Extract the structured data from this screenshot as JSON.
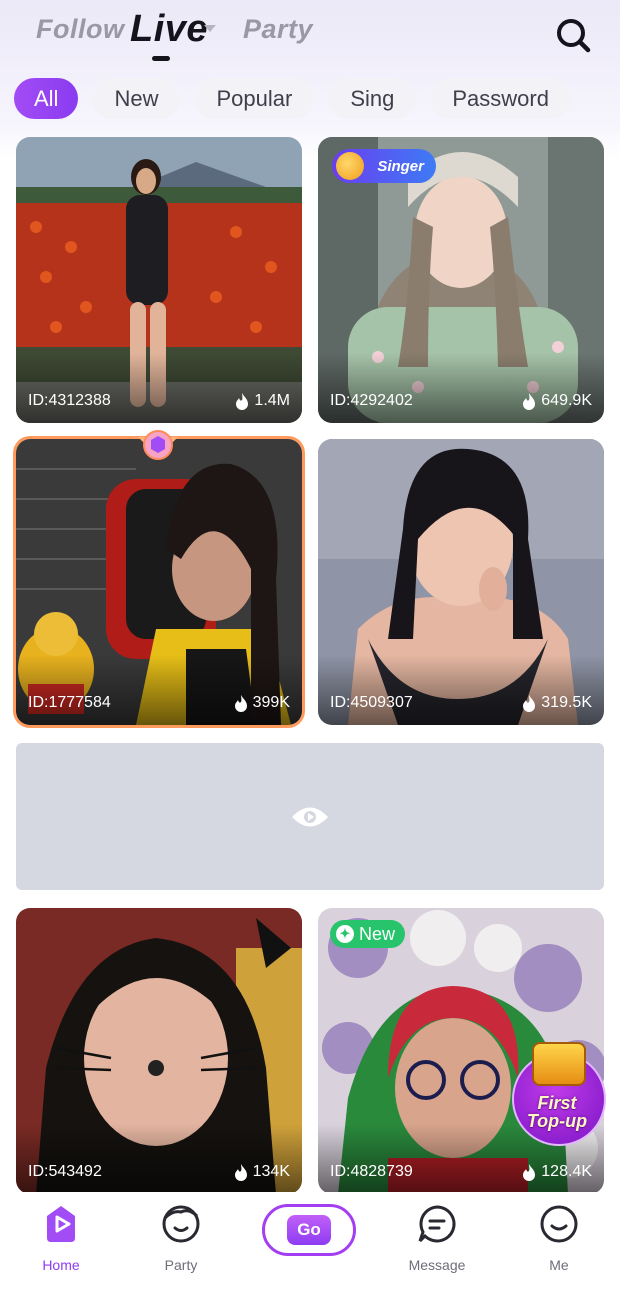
{
  "top_tabs": {
    "follow": "Follow",
    "live": "Live",
    "party": "Party"
  },
  "filters": [
    "All",
    "New",
    "Popular",
    "Sing",
    "Password"
  ],
  "cards": [
    {
      "id": "ID:4312388",
      "viewers": "1.4M"
    },
    {
      "id": "ID:4292402",
      "viewers": "649.9K",
      "badge": "Singer"
    },
    {
      "id": "ID:1777584",
      "viewers": "399K"
    },
    {
      "id": "ID:4509307",
      "viewers": "319.5K"
    },
    {
      "id": "ID:543492",
      "viewers": "134K"
    },
    {
      "id": "ID:4828739",
      "viewers": "128.4K",
      "badge": "New"
    }
  ],
  "promo": {
    "line1": "First",
    "line2": "Top-up"
  },
  "nav": {
    "home": "Home",
    "party": "Party",
    "go": "Go",
    "message": "Message",
    "me": "Me"
  },
  "colors": {
    "accent": "#8e3cf3",
    "highlight_border": "#ff9a5c",
    "new_badge": "#27c46b"
  },
  "icons": [
    "search-icon",
    "flame-icon",
    "eye-icon",
    "home-icon",
    "party-icon",
    "message-icon",
    "me-icon"
  ]
}
